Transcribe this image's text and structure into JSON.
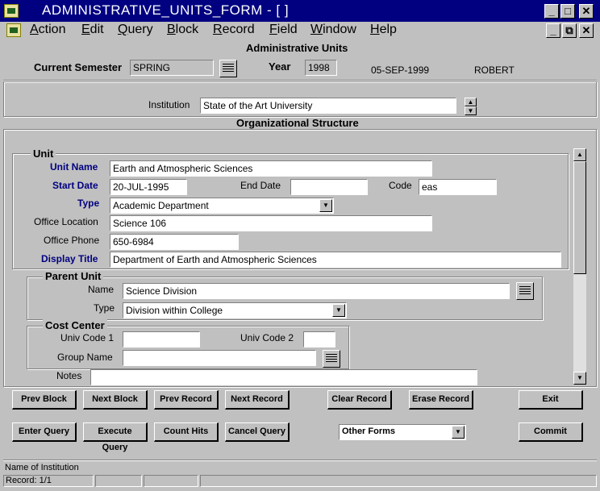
{
  "window": {
    "title": "ADMINISTRATIVE_UNITS_FORM - [ ]",
    "minimize": "_",
    "maximize": "□",
    "close": "✕",
    "restore": "⧉"
  },
  "menu": [
    "Action",
    "Edit",
    "Query",
    "Block",
    "Record",
    "Field",
    "Window",
    "Help"
  ],
  "header": {
    "form_title": "Administrative Units",
    "semester_label": "Current Semester",
    "semester_value": "SPRING",
    "year_label": "Year",
    "year_value": "1998",
    "date": "05-SEP-1999",
    "user": "ROBERT"
  },
  "institution": {
    "label": "Institution",
    "value": "State of the Art University"
  },
  "org_title": "Organizational Structure",
  "unit": {
    "legend": "Unit",
    "name_label": "Unit Name",
    "name_value": "Earth and Atmospheric Sciences",
    "start_label": "Start Date",
    "start_value": "20-JUL-1995",
    "end_label": "End Date",
    "end_value": "",
    "code_label": "Code",
    "code_value": "eas",
    "type_label": "Type",
    "type_value": "Academic Department",
    "office_label": "Office Location",
    "office_value": "Science 106",
    "phone_label": "Office Phone",
    "phone_value": "650-6984",
    "display_label": "Display Title",
    "display_value": "Department of Earth and Atmospheric Sciences"
  },
  "parent": {
    "legend": "Parent Unit",
    "name_label": "Name",
    "name_value": "Science Division",
    "type_label": "Type",
    "type_value": "Division within College"
  },
  "cost": {
    "legend": "Cost Center",
    "code1_label": "Univ Code 1",
    "code1_value": "",
    "code2_label": "Univ Code 2",
    "code2_value": "",
    "group_label": "Group Name",
    "group_value": ""
  },
  "notes": {
    "label": "Notes",
    "value": ""
  },
  "buttons": {
    "prev_block": "Prev Block",
    "next_block": "Next Block",
    "prev_record": "Prev Record",
    "next_record": "Next Record",
    "clear_record": "Clear Record",
    "erase_record": "Erase Record",
    "exit": "Exit",
    "enter_query": "Enter Query",
    "execute_query": "Execute Query",
    "count_hits": "Count Hits",
    "cancel_query": "Cancel Query",
    "other_forms": "Other Forms",
    "commit": "Commit"
  },
  "status": {
    "hint": "Name of Institution",
    "record": "Record: 1/1"
  }
}
